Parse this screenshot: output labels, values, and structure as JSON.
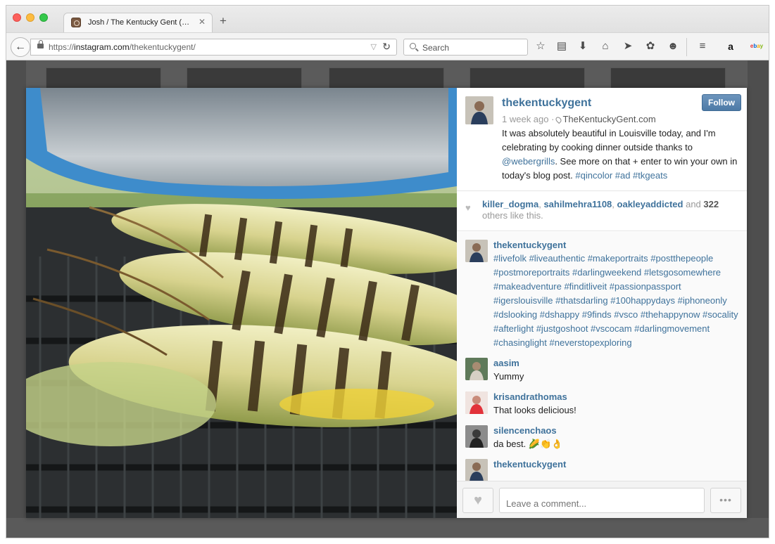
{
  "browser": {
    "tab_title": "Josh / The Kentucky Gent (…",
    "new_tab_label": "+",
    "url_prefix": "https://",
    "url_domain": "instagram.com",
    "url_path": "/thekentuckygent/",
    "search_placeholder": "Search"
  },
  "post": {
    "username": "thekentuckygent",
    "follow_label": "Follow",
    "time": "1 week ago ·",
    "location": "TheKentuckyGent.com",
    "caption_text": "It was absolutely beautiful in Louisville today, and I'm celebrating by cooking dinner outside thanks to ",
    "caption_mention": "@webergrills",
    "caption_text2": ". See more on that + enter to win your own in today's blog post. ",
    "caption_tags": "#qincolor #ad #tkgeats"
  },
  "likes": {
    "users": [
      "killer_dogma",
      "sahilmehra1108",
      "oakleyaddicted"
    ],
    "and": "and",
    "count": "322",
    "suffix": "others like this."
  },
  "comments": [
    {
      "user": "thekentuckygent",
      "text": "#livefolk #liveauthentic #makeportraits #postthepeople #postmoreportraits #darlingweekend #letsgosomewhere #makeadventure #finditliveit #passionpassport #igerslouisville #thatsdarling #100happydays #iphoneonly #dslooking #dshappy #9finds #vsco #thehappynow #socality #afterlight #justgoshoot #vscocam #darlingmovement #chasinglight #neverstopexploring"
    },
    {
      "user": "aasim",
      "text": "Yummy"
    },
    {
      "user": "krisandrathomas",
      "text": "That looks delicious!"
    },
    {
      "user": "silencenchaos",
      "text": "da best. 🌽👏👌"
    },
    {
      "user": "thekentuckygent",
      "text": ""
    }
  ],
  "footer": {
    "comment_placeholder": "Leave a comment...",
    "more_label": "•••"
  },
  "icons": {
    "toolbar": [
      "star-icon",
      "reading-list-icon",
      "download-icon",
      "home-icon",
      "send-icon",
      "pocket-icon",
      "emoji-icon",
      "menu-icon",
      "amazon-icon",
      "ebay-icon"
    ]
  }
}
